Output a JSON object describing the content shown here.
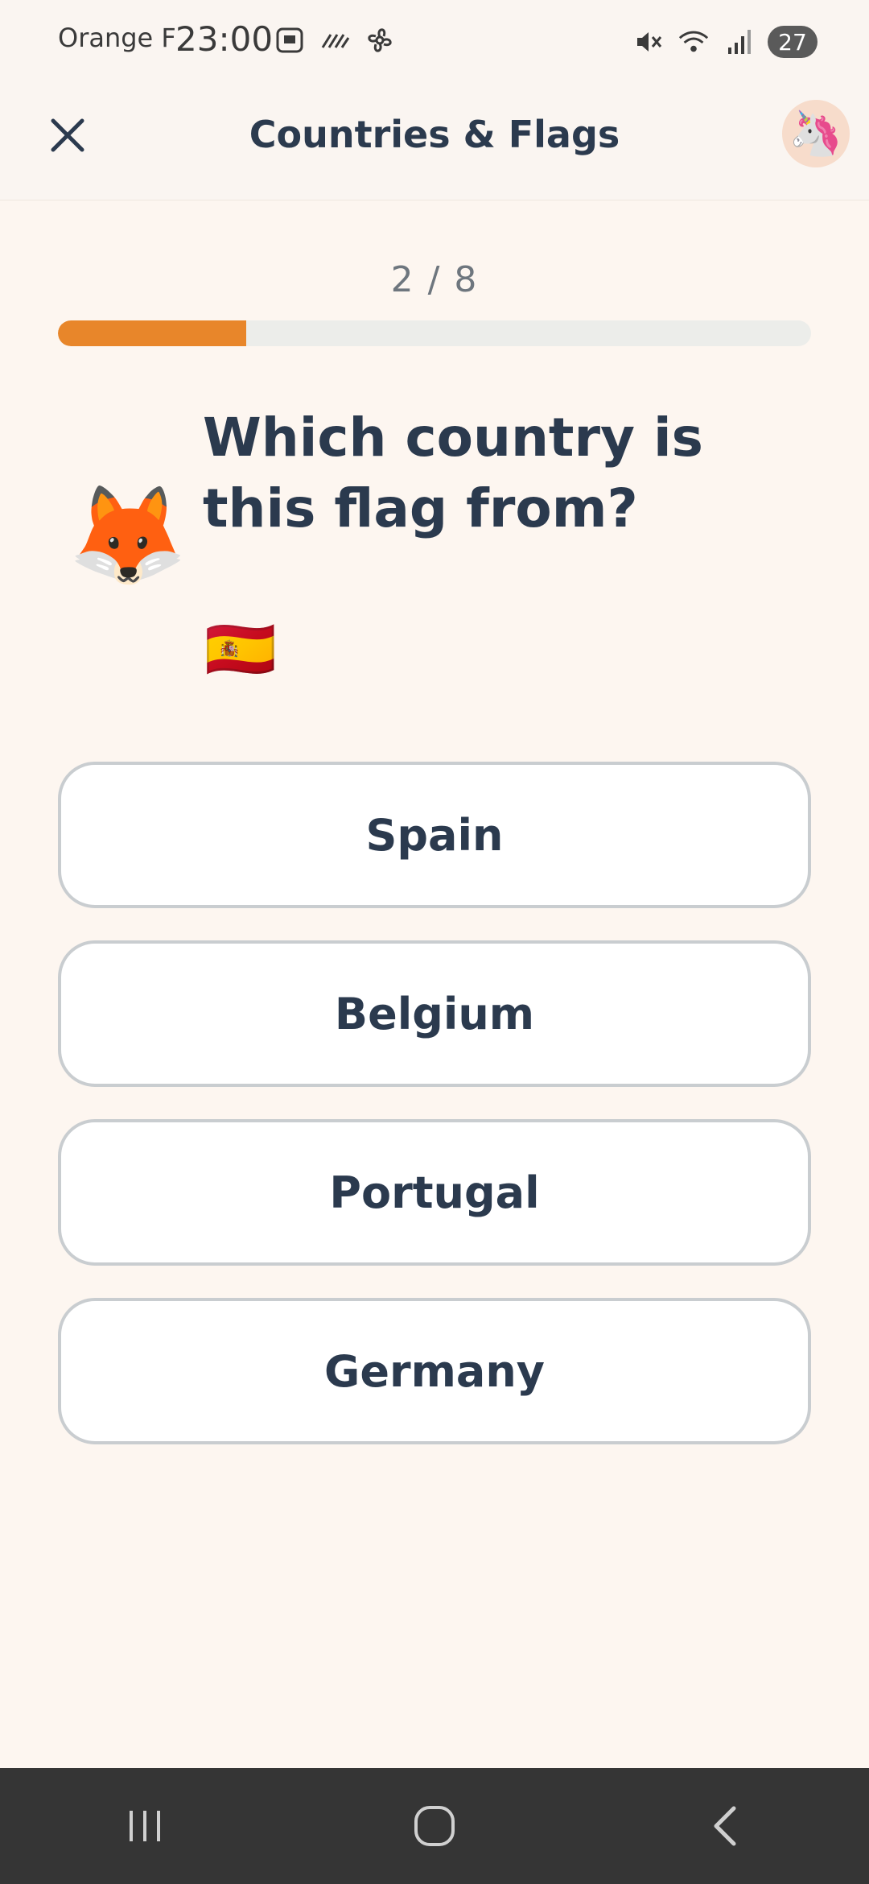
{
  "status_bar": {
    "carrier": "Orange F",
    "time": "23:00",
    "battery": "27",
    "icons_left": [
      "screenshot-icon",
      "data-saver-icon",
      "fan-icon"
    ],
    "icons_right": [
      "mute-icon",
      "wifi-icon",
      "signal-icon"
    ]
  },
  "header": {
    "title": "Countries & Flags",
    "avatar": "🦄"
  },
  "progress": {
    "counter": "2 / 8",
    "current": 2,
    "total": 8,
    "fraction": 0.25,
    "color": "#E8862A"
  },
  "question": {
    "mascot": "🦊",
    "text": "Which country is this flag from?",
    "flag": "🇪🇸"
  },
  "answers": [
    "Spain",
    "Belgium",
    "Portugal",
    "Germany"
  ],
  "nav": [
    "recent-apps-button",
    "home-button",
    "back-button"
  ]
}
